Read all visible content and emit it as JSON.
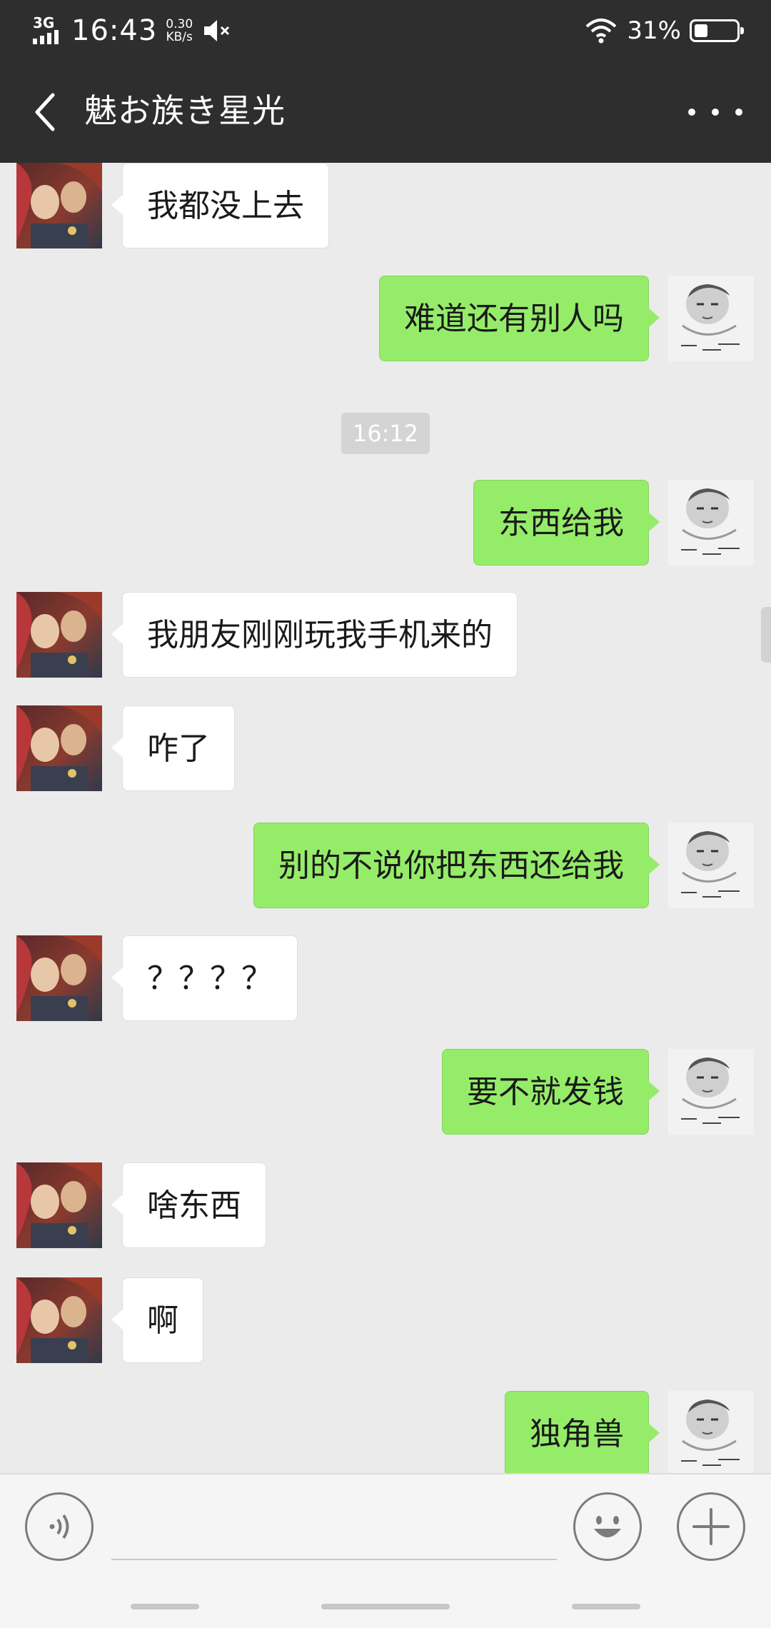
{
  "status_bar": {
    "network": "3G",
    "time": "16:43",
    "speed_value": "0.30",
    "speed_unit": "KB/s",
    "battery_text": "31%",
    "battery_level": 0.31
  },
  "header": {
    "title": "魅お族き星光",
    "back_icon": "chevron-left-icon",
    "more_icon": "more-dots-icon"
  },
  "messages": [
    {
      "side": "left",
      "text": "我都没上去"
    },
    {
      "side": "right",
      "text": "难道还有别人吗"
    },
    {
      "side": "right",
      "text": "东西给我"
    },
    {
      "side": "left",
      "text": "我朋友刚刚玩我手机来的"
    },
    {
      "side": "left",
      "text": "咋了"
    },
    {
      "side": "right",
      "text": "别的不说你把东西还给我"
    },
    {
      "side": "left",
      "text": "？？？？"
    },
    {
      "side": "right",
      "text": "要不就发钱"
    },
    {
      "side": "left",
      "text": "啥东西"
    },
    {
      "side": "left",
      "text": "啊"
    },
    {
      "side": "right",
      "text": "独角兽"
    }
  ],
  "timestamp": "16:12",
  "input_bar": {
    "voice_icon": "voice-icon",
    "emoji_icon": "emoji-icon",
    "plus_icon": "plus-icon",
    "input_value": ""
  },
  "colors": {
    "header_bg": "#2e2e2e",
    "chat_bg": "#ebebeb",
    "sent_bubble": "#95ec69",
    "received_bubble": "#ffffff"
  }
}
